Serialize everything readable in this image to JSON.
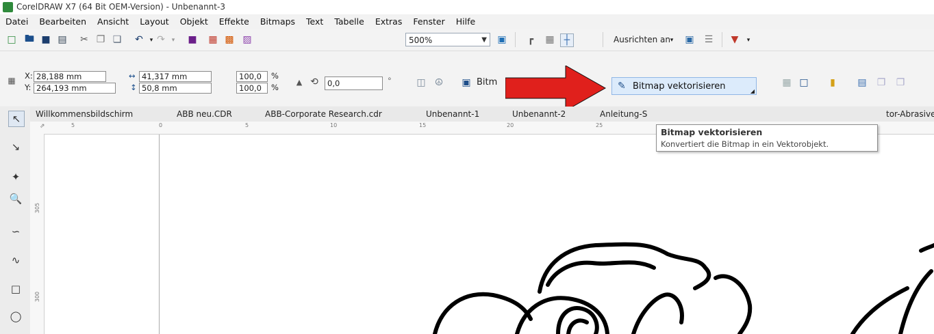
{
  "window": {
    "title": "CorelDRAW X7 (64 Bit OEM-Version) - Unbenannt-3"
  },
  "menu": [
    "Datei",
    "Bearbeiten",
    "Ansicht",
    "Layout",
    "Objekt",
    "Effekte",
    "Bitmaps",
    "Text",
    "Tabelle",
    "Extras",
    "Fenster",
    "Hilfe"
  ],
  "toolbar": {
    "zoom_value": "500%",
    "snap_label": "Ausrichten an"
  },
  "property_bar": {
    "x_label": "X:",
    "x_value": "28,188 mm",
    "y_label": "Y:",
    "y_value": "264,193 mm",
    "width_value": "41,317 mm",
    "height_value": "50,8 mm",
    "scale_x": "100,0",
    "scale_y": "100,0",
    "percent_symbol": "%",
    "rotation_value": "0,0",
    "degree_symbol": "°",
    "bitmap_partial_label": "Bitm",
    "trace_bitmap_button": "Bitmap vektorisieren"
  },
  "tabs": [
    "Willkommensbildschirm",
    "ABB neu.CDR",
    "ABB-Corporate Research.cdr",
    "Unbenannt-1",
    "Unbenannt-2",
    "Anleitung-S",
    "tor-Abrasive"
  ],
  "tooltip": {
    "title": "Bitmap vektorisieren",
    "description": "Konvertiert die Bitmap in ein Vektorobjekt."
  },
  "ruler": {
    "h_ticks": [
      "5",
      "0",
      "5",
      "10",
      "15",
      "20",
      "25"
    ],
    "v_ticks": [
      "305",
      "300"
    ]
  },
  "colors": {
    "arrow": "#e0201c",
    "highlight": "#dcebfb",
    "logo": "#2f8a3c"
  }
}
